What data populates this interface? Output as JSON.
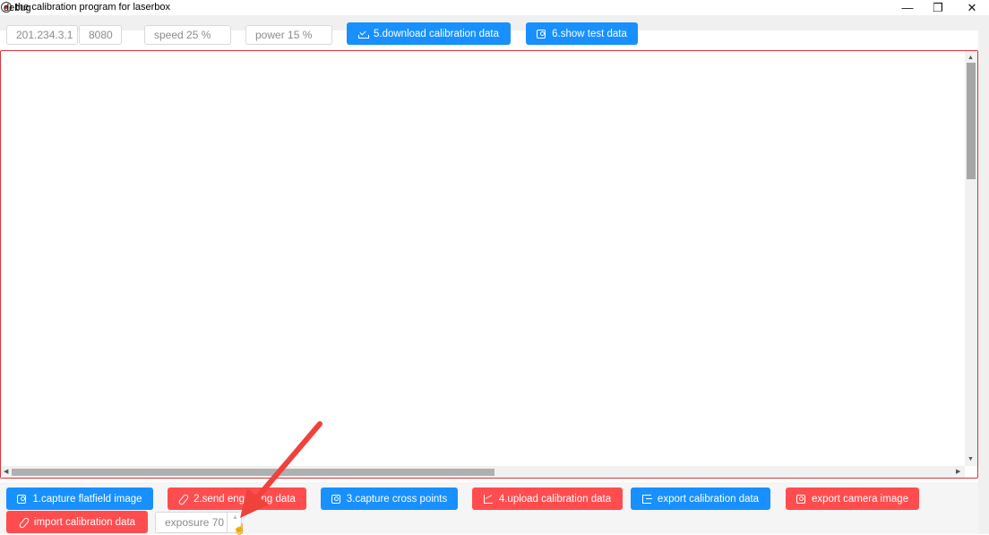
{
  "window": {
    "title": "the calibration program for laserbox",
    "controls": {
      "minimize": "—",
      "restore": "❐",
      "close": "✕"
    }
  },
  "menu": {
    "items": [
      "debug"
    ]
  },
  "top_inputs": {
    "ip": "201.234.3.1",
    "port": "8080",
    "speed": "speed 25 %",
    "power": "power 15 %"
  },
  "top_buttons": {
    "download": "5.download calibration data",
    "show_test": "6.show test data"
  },
  "bottom_buttons": {
    "capture_flatfield": "1.capture flatfield image",
    "send_engrave": "2.send engraving data",
    "capture_cross": "3.capture cross points",
    "upload_calibration": "4.upload calibration data",
    "export_calibration": "export calibration data",
    "export_camera": "export camera image",
    "import_calibration": "import calibration data"
  },
  "exposure": {
    "value": "exposure 70"
  },
  "colors": {
    "primary": "#1890ff",
    "danger": "#ff4d4f",
    "canvas_border": "#d9363e",
    "annotation_arrow": "#f0413b"
  },
  "icons": {
    "download": "download-icon",
    "camera": "camera-icon",
    "clip": "paperclip-icon",
    "chart": "line-chart-icon",
    "export": "export-icon"
  }
}
